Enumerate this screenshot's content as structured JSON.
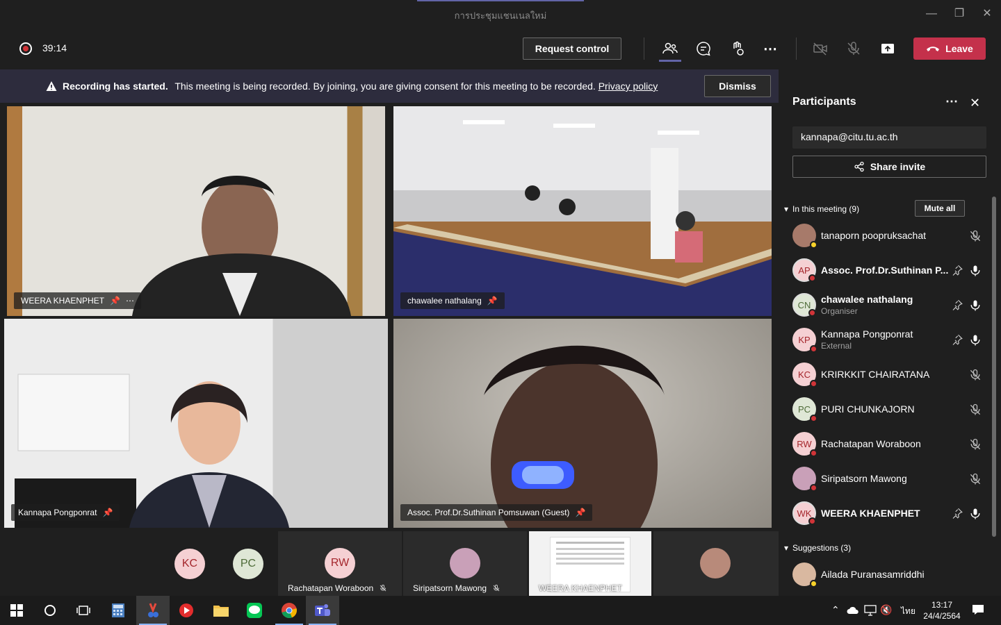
{
  "window": {
    "title": "การประชุมแชนเนลใหม่"
  },
  "toolbar": {
    "timer": "39:14",
    "request_control": "Request control",
    "leave": "Leave"
  },
  "banner": {
    "bold": "Recording has started.",
    "text": "This meeting is being recorded. By joining, you are giving consent for this meeting to be recorded.",
    "link": "Privacy policy",
    "dismiss": "Dismiss"
  },
  "videos": [
    {
      "name": "WEERA KHAENPHET"
    },
    {
      "name": "chawalee nathalang"
    },
    {
      "name": "Kannapa Pongponrat"
    },
    {
      "name": "Assoc. Prof.Dr.Suthinan Pomsuwan (Guest)"
    }
  ],
  "strip": {
    "kc": "KC",
    "pc": "PC",
    "rw_initials": "RW",
    "rw_name": "Rachatapan Woraboon",
    "sm_name": "Siripatsorn Mawong",
    "share_name": "WEERA KHAENPHET"
  },
  "panel": {
    "title": "Participants",
    "email": "kannapa@citu.tu.ac.th",
    "share_invite": "Share invite",
    "in_meeting": "In this meeting (9)",
    "mute_all": "Mute all",
    "suggestions": "Suggestions (3)",
    "participants": [
      {
        "initials": "",
        "name": "tanaporn poopruksachat",
        "sub": ""
      },
      {
        "initials": "AP",
        "name": "Assoc. Prof.Dr.Suthinan P...",
        "sub": ""
      },
      {
        "initials": "CN",
        "name": "chawalee nathalang",
        "sub": "Organiser"
      },
      {
        "initials": "KP",
        "name": "Kannapa Pongponrat",
        "sub": "External"
      },
      {
        "initials": "KC",
        "name": "KRIRKKIT CHAIRATANA",
        "sub": ""
      },
      {
        "initials": "PC",
        "name": "PURI CHUNKAJORN",
        "sub": ""
      },
      {
        "initials": "RW",
        "name": "Rachatapan Woraboon",
        "sub": ""
      },
      {
        "initials": "",
        "name": "Siripatsorn Mawong",
        "sub": ""
      },
      {
        "initials": "WK",
        "name": "WEERA KHAENPHET",
        "sub": ""
      }
    ],
    "suggested": [
      {
        "name": "Ailada Puranasamriddhi"
      }
    ]
  },
  "taskbar": {
    "time": "13:17",
    "date": "24/4/2564",
    "lang": "ไทย"
  },
  "colors": {
    "leave": "#c4314b",
    "banner": "#2d2c3d",
    "accent": "#6264a7",
    "busy": "#d13438",
    "away": "#f8d22a"
  }
}
